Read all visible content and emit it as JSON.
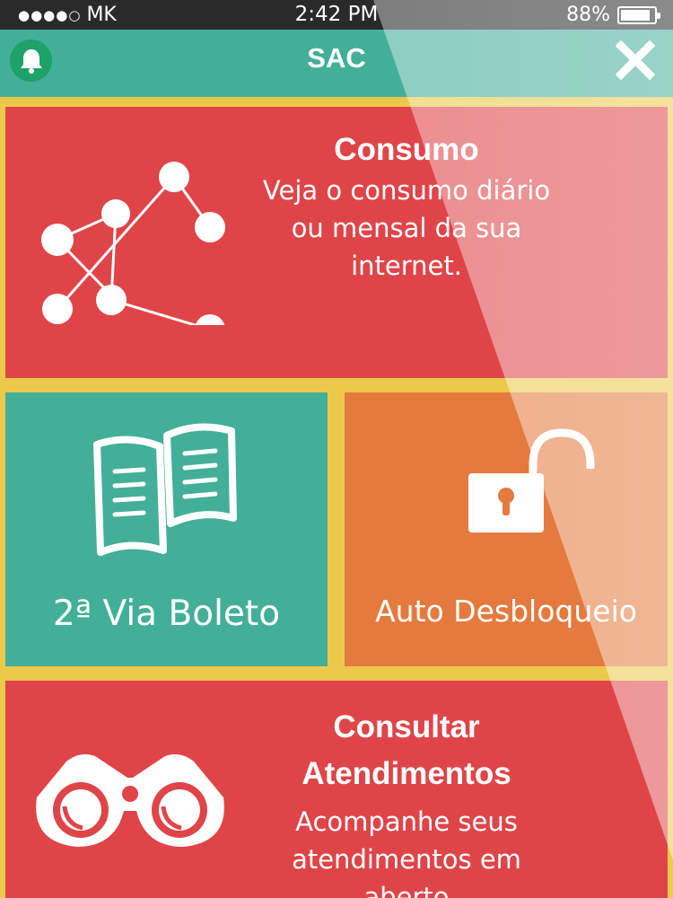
{
  "status_bar": {
    "signal_dots": "●●●●○",
    "carrier": "MK",
    "time": "2:42 PM",
    "battery": "88%",
    "battery_level": 0.88
  },
  "nav": {
    "title": "SAC",
    "left_icon": "bell-icon",
    "right_icon": "close-icon"
  },
  "tiles": {
    "consumo": {
      "title": "Consumo",
      "description": "Veja o consumo diário ou mensal da sua internet.",
      "icon": "line-graph-icon",
      "color": "#DF4548"
    },
    "boleto": {
      "label": "2ª Via Boleto",
      "icon": "documents-icon",
      "color": "#43AF98"
    },
    "desbloqueio": {
      "label": "Auto Desbloqueio",
      "icon": "unlocked-padlock-icon",
      "color": "#E57A3E"
    },
    "atendimentos": {
      "title": "Consultar Atendimentos",
      "description": "Acompanhe seus atendimentos em aberto",
      "icon": "binoculars-icon",
      "color": "#DF4548"
    }
  },
  "colors": {
    "background": "#ECC94B",
    "nav_bar": "#43AF98",
    "bell_button": "#1FA16A"
  }
}
